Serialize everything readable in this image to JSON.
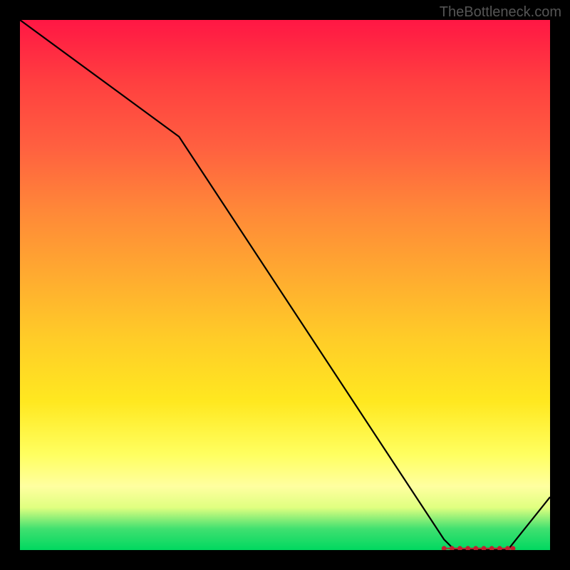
{
  "watermark": "TheBottleneck.com",
  "chart_data": {
    "type": "line",
    "title": "",
    "xlabel": "",
    "ylabel": "",
    "xlim": [
      0,
      100
    ],
    "ylim": [
      0,
      100
    ],
    "series": [
      {
        "name": "bottleneck-curve",
        "x": [
          0,
          30,
          80,
          82,
          90,
          92,
          100
        ],
        "values": [
          100,
          78,
          2,
          0,
          0,
          0,
          10
        ]
      }
    ],
    "optimal_zone": {
      "start_x": 80,
      "end_x": 93,
      "markers_x": [
        80,
        81.5,
        83,
        84.5,
        86,
        87.5,
        89,
        90.5,
        92,
        93
      ],
      "marker_color": "#c02030"
    },
    "background": {
      "type": "vertical-gradient",
      "stops": [
        {
          "pct": 0,
          "color": "#ff1744"
        },
        {
          "pct": 50,
          "color": "#ffb030"
        },
        {
          "pct": 82,
          "color": "#ffff60"
        },
        {
          "pct": 100,
          "color": "#00d860"
        }
      ]
    }
  }
}
